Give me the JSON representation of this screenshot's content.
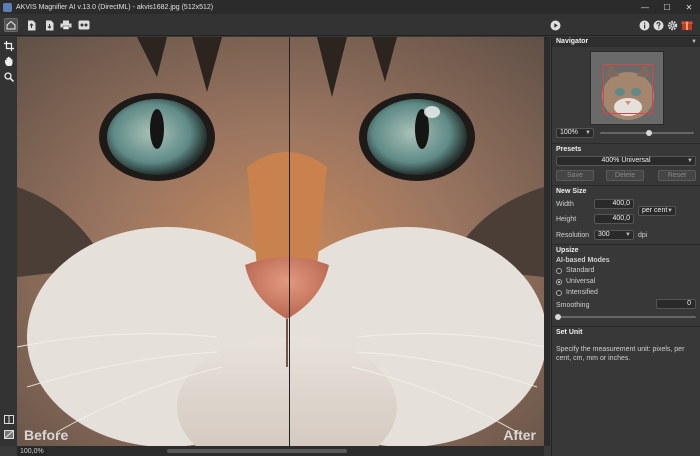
{
  "window": {
    "title": "AKVIS Magnifier AI v.13.0 (DirectML) - akvis1682.jpg (512x512)",
    "controls": [
      "—",
      "☐",
      "✕"
    ]
  },
  "toolbar": {
    "home_icon": "home-icon",
    "open_icon": "open-file-icon",
    "save_icon": "save-file-icon",
    "print_icon": "print-icon",
    "batch_icon": "batch-icon",
    "run_icon": "run-icon",
    "info_icon": "info-icon",
    "help_icon": "help-icon",
    "settings_icon": "gear-icon",
    "gift_icon": "gift-icon"
  },
  "tools": [
    "crop-icon",
    "hand-icon",
    "zoom-icon"
  ],
  "view": {
    "before_label": "Before",
    "after_label": "After",
    "zoom_status": "100,0%"
  },
  "panel": {
    "navigator": {
      "title": "Navigator",
      "zoom": "100%",
      "zoom_slider_fraction": 0.5
    },
    "presets": {
      "title": "Presets",
      "selected": "400% Universal",
      "save": "Save",
      "delete": "Delete",
      "reset": "Reset"
    },
    "new_size": {
      "title": "New Size",
      "width_label": "Width",
      "width_value": "400,0",
      "height_label": "Height",
      "height_value": "400,0",
      "unit": "per cent",
      "resolution_label": "Resolution",
      "resolution_value": "300",
      "resolution_unit": "dpi"
    },
    "upsize": {
      "title": "Upsize",
      "modes_label": "AI-based Modes",
      "modes": [
        "Standard",
        "Universal",
        "Intensified"
      ],
      "selected_mode_index": 1,
      "smoothing_label": "Smoothing",
      "smoothing_value": "0"
    },
    "set_unit": {
      "title": "Set Unit",
      "hint": "Specify the measurement unit: pixels, per cent, cm, mm or inches."
    }
  },
  "colors": {
    "background": "#3a3a3a",
    "panel": "#383838",
    "accent_red": "#c0392b"
  }
}
